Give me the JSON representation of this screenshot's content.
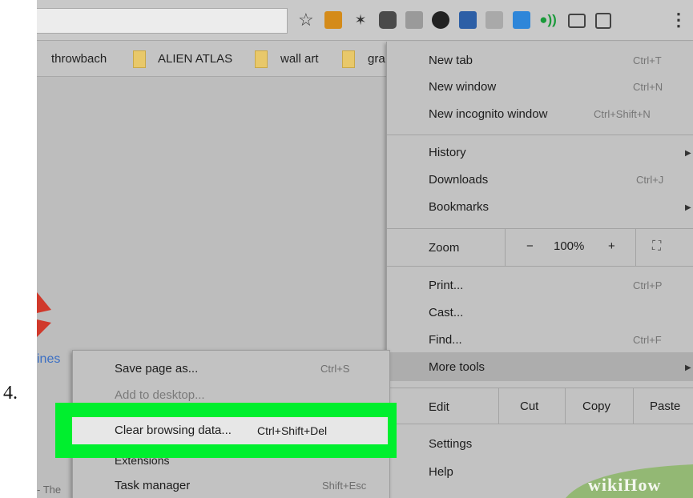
{
  "step_number": "4.",
  "bookmarks": [
    {
      "label": "throwbach"
    },
    {
      "label": "ALIEN ATLAS"
    },
    {
      "label": "wall art"
    },
    {
      "label": "gra"
    }
  ],
  "page": {
    "link_text": "ines",
    "footer_text": "- The"
  },
  "main_menu": {
    "new_tab": {
      "label": "New tab",
      "shortcut": "Ctrl+T"
    },
    "new_window": {
      "label": "New window",
      "shortcut": "Ctrl+N"
    },
    "new_incognito": {
      "label": "New incognito window",
      "shortcut": "Ctrl+Shift+N"
    },
    "history": {
      "label": "History"
    },
    "downloads": {
      "label": "Downloads",
      "shortcut": "Ctrl+J"
    },
    "bookmarks": {
      "label": "Bookmarks"
    },
    "zoom": {
      "label": "Zoom",
      "minus": "−",
      "level": "100%",
      "plus": "+",
      "fullscreen": "⛶"
    },
    "print": {
      "label": "Print...",
      "shortcut": "Ctrl+P"
    },
    "cast": {
      "label": "Cast..."
    },
    "find": {
      "label": "Find...",
      "shortcut": "Ctrl+F"
    },
    "more_tools": {
      "label": "More tools"
    },
    "edit": {
      "label": "Edit",
      "cut": "Cut",
      "copy": "Copy",
      "paste": "Paste"
    },
    "settings": {
      "label": "Settings"
    },
    "help": {
      "label": "Help"
    }
  },
  "sub_menu": {
    "save_page": {
      "label": "Save page as...",
      "shortcut": "Ctrl+S"
    },
    "add_to_desktop": {
      "label": "Add to desktop..."
    },
    "clear_browsing": {
      "label": "Clear browsing data...",
      "shortcut": "Ctrl+Shift+Del"
    },
    "extensions": {
      "label": "Extensions"
    },
    "task_manager": {
      "label": "Task manager",
      "shortcut": "Shift+Esc"
    }
  },
  "watermark": {
    "text": "wikiHow",
    "color": "#93b874"
  },
  "colors": {
    "highlight_green": "#00ef2e",
    "menu_bg": "#c2c2c2"
  },
  "icons": [
    "star-icon",
    "extension-icons",
    "menu-dots-icon",
    "folder-icon",
    "submenu-arrow-icon"
  ]
}
